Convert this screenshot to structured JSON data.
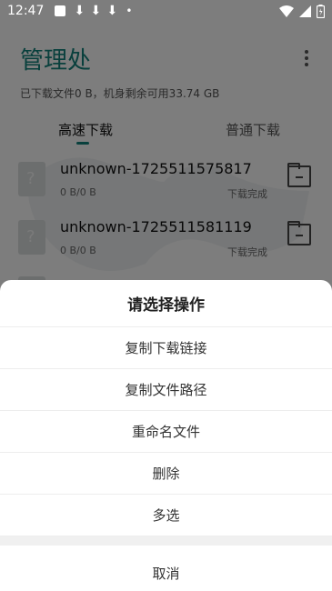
{
  "status_bar": {
    "time": "12:47",
    "icons": [
      "notification-square-icon",
      "download-icon",
      "download-icon",
      "download-icon",
      "dot-icon",
      "wifi-icon",
      "cellular-icon",
      "battery-icon"
    ],
    "download_glyph": "⬇",
    "dot_glyph": "•"
  },
  "app": {
    "title": "管理处",
    "storage_text": "已下载文件0 B，机身剩余可用33.74 GB",
    "tabs": [
      {
        "label": "高速下载",
        "active": true
      },
      {
        "label": "普通下载",
        "active": false
      }
    ],
    "files": [
      {
        "name": "unknown-1725511575817",
        "size": "0 B/0 B",
        "status": "下载完成"
      },
      {
        "name": "unknown-1725511581119",
        "size": "0 B/0 B",
        "status": "下载完成"
      }
    ],
    "accent_color": "#13807a"
  },
  "sheet": {
    "title": "请选择操作",
    "options": [
      "复制下载链接",
      "复制文件路径",
      "重命名文件",
      "删除",
      "多选"
    ],
    "cancel": "取消"
  }
}
